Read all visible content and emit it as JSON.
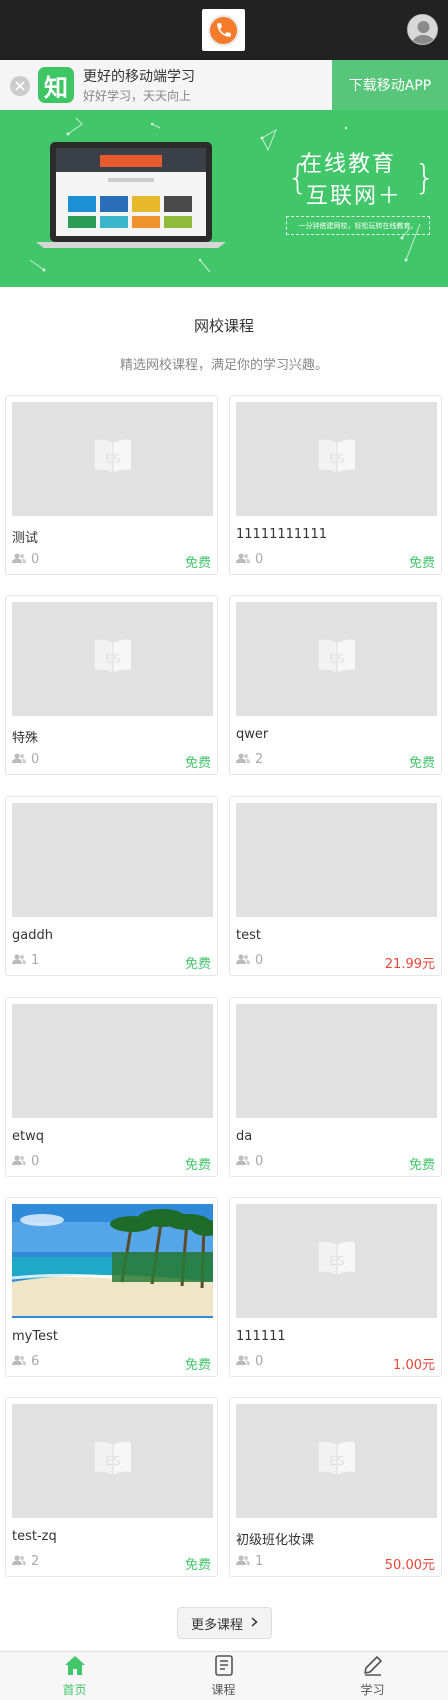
{
  "header": {
    "logo_icon": "phone-logo-icon",
    "avatar_icon": "user-avatar-icon"
  },
  "app_banner": {
    "icon_char": "知",
    "title": "更好的移动端学习",
    "subtitle": "好好学习，天天向上",
    "download_label": "下载移动APP",
    "accent": "#42c66a"
  },
  "hero": {
    "title_line1": "在线教育",
    "title_line2": "互联网＋",
    "subtitle": "一分钟搭建网校，轻松玩转在线教育。",
    "bg_color": "#42c66a"
  },
  "section": {
    "title": "网校课程",
    "subtitle": "精选网校课程，满足你的学习兴趣。"
  },
  "courses": [
    {
      "title": "测试",
      "students": "0",
      "price": "免费",
      "paid": false,
      "image": "placeholder"
    },
    {
      "title": "11111111111",
      "students": "0",
      "price": "免费",
      "paid": false,
      "image": "placeholder"
    },
    {
      "title": "特殊",
      "students": "0",
      "price": "免费",
      "paid": false,
      "image": "placeholder"
    },
    {
      "title": "qwer",
      "students": "2",
      "price": "免费",
      "paid": false,
      "image": "placeholder"
    },
    {
      "title": "gaddh",
      "students": "1",
      "price": "免费",
      "paid": false,
      "image": "blank"
    },
    {
      "title": "test",
      "students": "0",
      "price": "21.99元",
      "paid": true,
      "image": "blank"
    },
    {
      "title": "etwq",
      "students": "0",
      "price": "免费",
      "paid": false,
      "image": "blank"
    },
    {
      "title": "da",
      "students": "0",
      "price": "免费",
      "paid": false,
      "image": "blank"
    },
    {
      "title": "myTest",
      "students": "6",
      "price": "免费",
      "paid": false,
      "image": "beach"
    },
    {
      "title": "111111",
      "students": "0",
      "price": "1.00元",
      "paid": true,
      "image": "placeholder"
    },
    {
      "title": "test-zq",
      "students": "2",
      "price": "免费",
      "paid": false,
      "image": "placeholder"
    },
    {
      "title": "初级班化妆课",
      "students": "1",
      "price": "50.00元",
      "paid": true,
      "image": "placeholder"
    }
  ],
  "more_button": {
    "label": "更多课程",
    "icon": "chevron-right-icon"
  },
  "bottom_nav": [
    {
      "label": "首页",
      "icon": "home-icon",
      "active": true
    },
    {
      "label": "课程",
      "icon": "book-icon",
      "active": false
    },
    {
      "label": "学习",
      "icon": "pencil-icon",
      "active": false
    }
  ]
}
